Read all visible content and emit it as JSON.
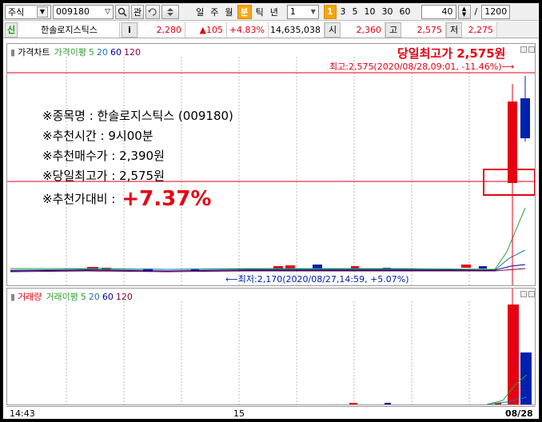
{
  "toolbar": {
    "market": "주식",
    "code": "009180",
    "kwan_label": "관",
    "periods": [
      "일",
      "주",
      "월",
      "분",
      "틱",
      "년"
    ],
    "selected_period": "분",
    "interval_value": "1",
    "intervals": [
      "1",
      "3",
      "5",
      "10",
      "30",
      "60"
    ],
    "selected_interval": "1",
    "count_value": "40",
    "slash": "/",
    "total_value": "1200"
  },
  "quote": {
    "badge": "신",
    "name": "한솔로지스틱스",
    "info_label": "i",
    "price": "2,280",
    "change": "▲105",
    "change_pct": "+4.83%",
    "volume": "14,635,038",
    "open_label": "시",
    "open": "2,360",
    "high_label": "고",
    "high": "2,575",
    "low_label": "저",
    "low": "2,275"
  },
  "price_pane": {
    "title": "가격차트",
    "ma_label": "가격이평",
    "ma_periods": [
      "5",
      "20",
      "60",
      "120"
    ],
    "high_marker": "최고:2,575(2020/08/28,09:01, -11.46%)⟶",
    "low_marker": "⟵최저:2,170(2020/08/27,14:59, +5.07%)"
  },
  "volume_pane": {
    "title": "거래량",
    "ma_label": "거래이평",
    "ma_periods": [
      "5",
      "20",
      "60",
      "120"
    ]
  },
  "x_axis": [
    "14:43",
    "15",
    "08/28"
  ],
  "overlay": {
    "headline": "당일최고가 2,575원",
    "lines": [
      "※종목명 : 한솔로지스틱스 (009180)",
      "※추천시간 : 9시00분",
      "※추천매수가 : 2,390원",
      "※당일최고가 : 2,575원"
    ],
    "ratio_label": "※추천가대비 :",
    "ratio_value": "+7.37%"
  },
  "colors": {
    "up": "#e60012",
    "down": "#0020b0",
    "ma5": "#2ca02c",
    "ma20": "#1f77b4",
    "ma60": "#0000a0",
    "ma120": "#8b0038"
  },
  "icons": [
    "search-icon",
    "refresh-icon",
    "spin-up-down-icon",
    "dropdown-icon"
  ]
}
